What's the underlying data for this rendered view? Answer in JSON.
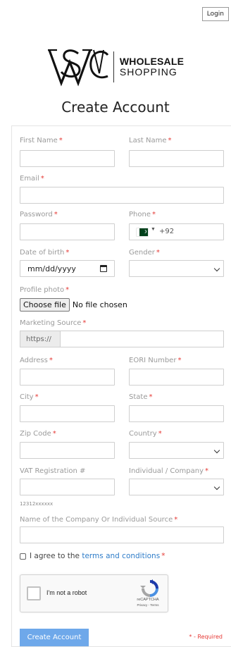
{
  "header": {
    "login_label": "Login"
  },
  "logo": {
    "monogram": "WSC",
    "line1": "WHOLESALE",
    "line2": "SHOPPING"
  },
  "page": {
    "title": "Create Account"
  },
  "form": {
    "required_mark": "*",
    "fields": {
      "first_name": {
        "label": "First Name",
        "value": ""
      },
      "last_name": {
        "label": "Last Name",
        "value": ""
      },
      "email": {
        "label": "Email",
        "value": ""
      },
      "password": {
        "label": "Password",
        "value": ""
      },
      "phone": {
        "label": "Phone",
        "country": "Pakistan",
        "dial_code": "+92"
      },
      "dob": {
        "label": "Date of birth",
        "placeholder": "mm/dd/yyyy"
      },
      "gender": {
        "label": "Gender",
        "selected": ""
      },
      "profile_photo": {
        "label": "Profile photo",
        "button_label": "Choose file",
        "status": "No file chosen"
      },
      "marketing_source": {
        "label": "Marketing Source",
        "prefix": "https://",
        "value": ""
      },
      "address": {
        "label": "Address",
        "value": ""
      },
      "eori": {
        "label": "EORI Number",
        "value": ""
      },
      "city": {
        "label": "City",
        "value": ""
      },
      "state": {
        "label": "State",
        "value": ""
      },
      "zip": {
        "label": "Zip Code",
        "value": ""
      },
      "country": {
        "label": "Country",
        "selected": ""
      },
      "vat": {
        "label": "VAT Registration #",
        "hint": "12312xxxxxx",
        "value": ""
      },
      "individual_company": {
        "label": "Individual / Company",
        "selected": ""
      },
      "company_name": {
        "label": "Name of the Company Or Individual Source",
        "value": ""
      }
    },
    "agree": {
      "prefix": "I agree to the ",
      "link": "terms and conditions",
      "checked": false
    },
    "captcha": {
      "label": "I'm not a robot",
      "brand": "reCAPTCHA",
      "terms": "Privacy - Terms"
    },
    "submit_label": "Create Account",
    "required_note": "* - Required"
  },
  "colors": {
    "accent": "#6ea8ea",
    "link": "#2f7dc9",
    "required": "#e53935",
    "label": "#9a9a9a"
  }
}
